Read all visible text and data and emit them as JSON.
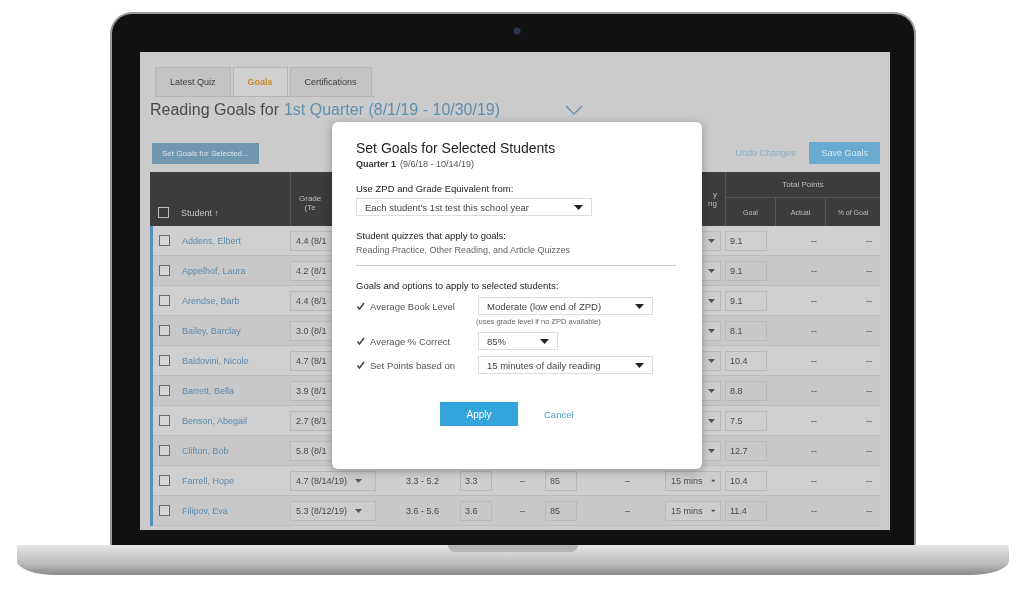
{
  "tabs": [
    {
      "label": "Latest Quiz",
      "selected": false
    },
    {
      "label": "Goals",
      "selected": true
    },
    {
      "label": "Certifications",
      "selected": false
    }
  ],
  "title": {
    "text": "Reading Goals for",
    "period": "1st Quarter (8/1/19 - 10/30/19)"
  },
  "toolbar": {
    "set_goals_button": "Set Goals for Selected...",
    "undo_link": "Undo Changes",
    "save_button": "Save Goals"
  },
  "table": {
    "header": {
      "select_all_checked": false,
      "student": "Student ↑",
      "grade": "Grade\n(Te",
      "reading": "y\nng",
      "total_points": "Total Points",
      "goal": "Goal",
      "actual": "Actual",
      "pct_of_goal": "% of Goal"
    },
    "rows": [
      {
        "checked": false,
        "name": "Addens, Elbert",
        "grade": "4.4 (8/1",
        "goal": "9.1",
        "actual": "--",
        "pct_of_goal": "--"
      },
      {
        "checked": false,
        "name": "Appelhof, Laura",
        "grade": "4.2 (8/1",
        "goal": "9.1",
        "actual": "--",
        "pct_of_goal": "--"
      },
      {
        "checked": false,
        "name": "Arendse, Barb",
        "grade": "4.4 (8/1",
        "goal": "9.1",
        "actual": "--",
        "pct_of_goal": "--"
      },
      {
        "checked": false,
        "name": "Bailey, Barclay",
        "grade": "3.0 (8/1",
        "goal": "8.1",
        "actual": "--",
        "pct_of_goal": "--"
      },
      {
        "checked": false,
        "name": "Baldovini, Nicole",
        "grade": "4.7 (8/1",
        "goal": "10.4",
        "actual": "--",
        "pct_of_goal": "--"
      },
      {
        "checked": false,
        "name": "Barrett, Bella",
        "grade": "3.9 (8/1",
        "goal": "8.8",
        "actual": "--",
        "pct_of_goal": "--"
      },
      {
        "checked": false,
        "name": "Benson, Abegail",
        "grade": "2.7 (8/1",
        "goal": "7.5",
        "actual": "--",
        "pct_of_goal": "--"
      },
      {
        "checked": false,
        "name": "Clifton, Bob",
        "grade": "5.8 (8/1",
        "goal": "12.7",
        "actual": "--",
        "pct_of_goal": "--"
      },
      {
        "checked": false,
        "name": "Farrell, Hope",
        "grade": "4.7 (8/14/19)",
        "range": "3.3 - 5.2",
        "zpd": "3.3",
        "column_5": "–",
        "pct_correct": "85",
        "column_7": "–",
        "reading": "15 mins",
        "goal": "10.4",
        "actual": "--",
        "pct_of_goal": "--"
      },
      {
        "checked": false,
        "name": "Filipov, Eva",
        "grade": "5.3 (8/12/19)",
        "range": "3.6 - 5.6",
        "zpd": "3.6",
        "column_5": "–",
        "pct_correct": "85",
        "column_7": "–",
        "reading": "15 mins",
        "goal": "11.4",
        "actual": "--",
        "pct_of_goal": "--"
      }
    ]
  },
  "dialog": {
    "title": "Set Goals for Selected Students",
    "quarter": "Quarter 1",
    "quarter_dates": "(9/6/18 - 10/14/19)",
    "source_label": "Use ZPD and Grade Equivalent from:",
    "source_value": "Each student's 1st test this school year",
    "quizzes_label": "Student quizzes that apply to goals:",
    "quizzes_value": "Reading Practice, Other Reading, and Article Quizzes",
    "options_label": "Goals and options to apply to selected students:",
    "options": [
      {
        "checked": true,
        "label": "Average Book Level",
        "value": "Moderate (low end of ZPD)",
        "note": "(uses grade level if no ZPD available)"
      },
      {
        "checked": true,
        "label": "Average % Correct",
        "value": "85%"
      },
      {
        "checked": true,
        "label": "Set Points based on",
        "value": "15 minutes of daily reading"
      }
    ],
    "apply_button": "Apply",
    "cancel_link": "Cancel"
  }
}
